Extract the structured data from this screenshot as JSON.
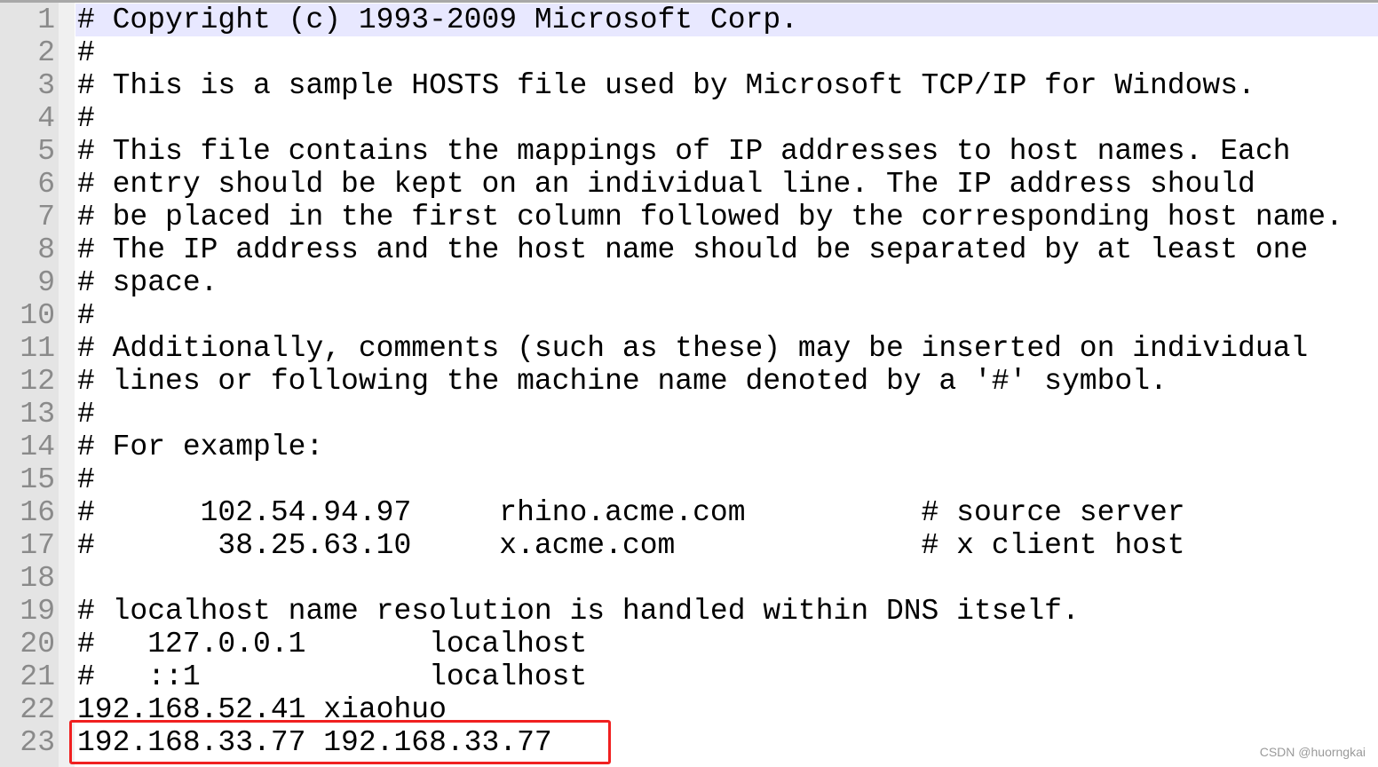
{
  "editor": {
    "current_line": 1,
    "lines": [
      {
        "n": "1",
        "text": "# Copyright (c) 1993-2009 Microsoft Corp."
      },
      {
        "n": "2",
        "text": "#"
      },
      {
        "n": "3",
        "text": "# This is a sample HOSTS file used by Microsoft TCP/IP for Windows."
      },
      {
        "n": "4",
        "text": "#"
      },
      {
        "n": "5",
        "text": "# This file contains the mappings of IP addresses to host names. Each"
      },
      {
        "n": "6",
        "text": "# entry should be kept on an individual line. The IP address should"
      },
      {
        "n": "7",
        "text": "# be placed in the first column followed by the corresponding host name."
      },
      {
        "n": "8",
        "text": "# The IP address and the host name should be separated by at least one"
      },
      {
        "n": "9",
        "text": "# space."
      },
      {
        "n": "10",
        "text": "#"
      },
      {
        "n": "11",
        "text": "# Additionally, comments (such as these) may be inserted on individual"
      },
      {
        "n": "12",
        "text": "# lines or following the machine name denoted by a '#' symbol."
      },
      {
        "n": "13",
        "text": "#"
      },
      {
        "n": "14",
        "text": "# For example:"
      },
      {
        "n": "15",
        "text": "#"
      },
      {
        "n": "16",
        "text": "#      102.54.94.97     rhino.acme.com          # source server"
      },
      {
        "n": "17",
        "text": "#       38.25.63.10     x.acme.com              # x client host"
      },
      {
        "n": "18",
        "text": ""
      },
      {
        "n": "19",
        "text": "# localhost name resolution is handled within DNS itself."
      },
      {
        "n": "20",
        "text": "#   127.0.0.1       localhost"
      },
      {
        "n": "21",
        "text": "#   ::1             localhost"
      },
      {
        "n": "22",
        "text": "192.168.52.41 xiaohuo"
      },
      {
        "n": "23",
        "text": "192.168.33.77 192.168.33.77"
      }
    ]
  },
  "highlight": {
    "line": "23",
    "color": "#f02020"
  },
  "watermark": "CSDN @huorngkai"
}
